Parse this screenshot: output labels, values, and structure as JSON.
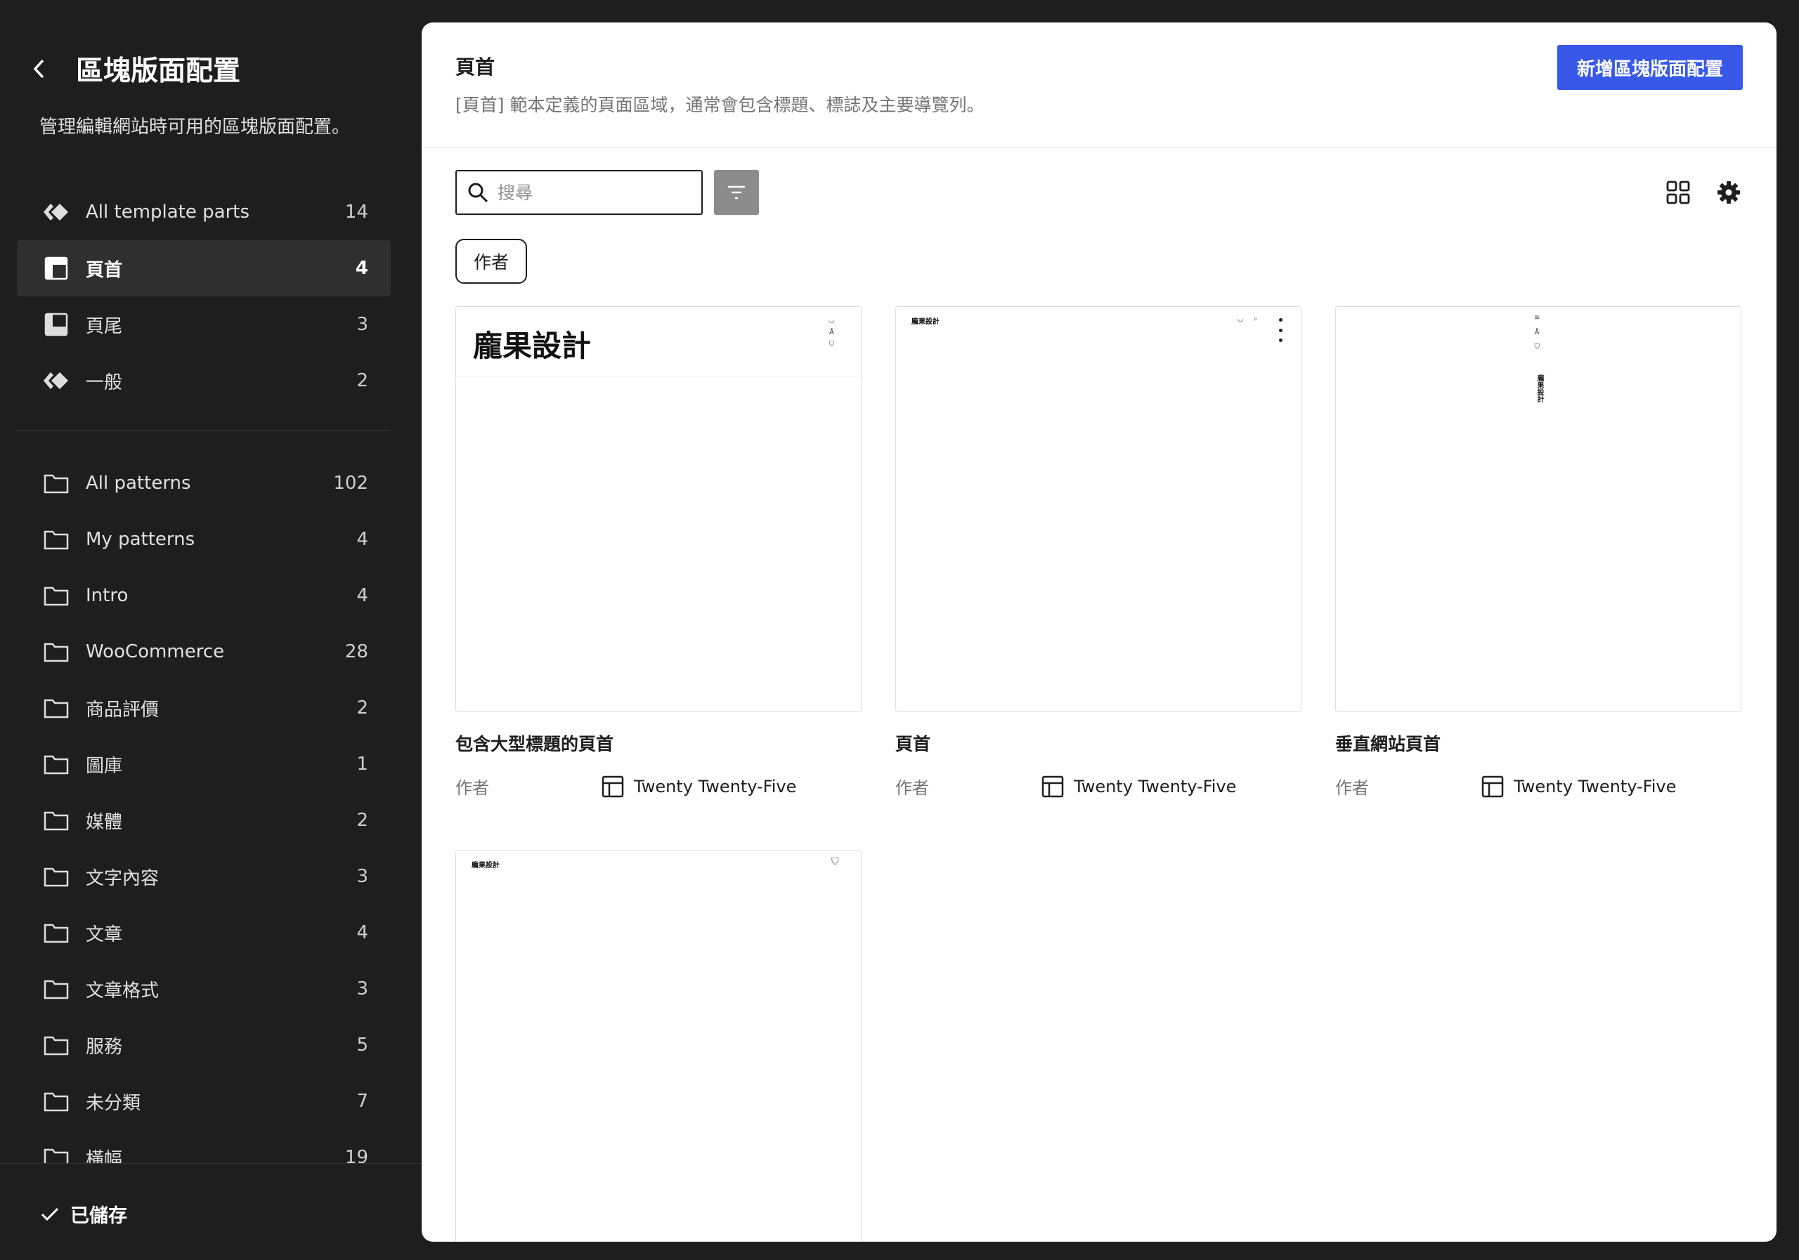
{
  "sidebar": {
    "title": "區塊版面配置",
    "description": "管理編輯網站時可用的區塊版面配置。",
    "template_parts": [
      {
        "label": "All template parts",
        "count": "14",
        "icon": "diamond-icon"
      },
      {
        "label": "頁首",
        "count": "4",
        "icon": "header-icon"
      },
      {
        "label": "頁尾",
        "count": "3",
        "icon": "footer-icon"
      },
      {
        "label": "一般",
        "count": "2",
        "icon": "diamond-icon"
      }
    ],
    "pattern_categories": [
      {
        "label": "All patterns",
        "count": "102"
      },
      {
        "label": "My patterns",
        "count": "4"
      },
      {
        "label": "Intro",
        "count": "4"
      },
      {
        "label": "WooCommerce",
        "count": "28"
      },
      {
        "label": "商品評價",
        "count": "2"
      },
      {
        "label": "圖庫",
        "count": "1"
      },
      {
        "label": "媒體",
        "count": "2"
      },
      {
        "label": "文字內容",
        "count": "3"
      },
      {
        "label": "文章",
        "count": "4"
      },
      {
        "label": "文章格式",
        "count": "3"
      },
      {
        "label": "服務",
        "count": "5"
      },
      {
        "label": "未分類",
        "count": "7"
      },
      {
        "label": "橫幅",
        "count": "19"
      }
    ],
    "saved_label": "已儲存"
  },
  "main": {
    "title": "頁首",
    "description": "[頁首] 範本定義的頁面區域，通常會包含標題、標誌及主要導覽列。",
    "add_button": "新增區塊版面配置",
    "search_placeholder": "搜尋",
    "filter_chip": "作者",
    "cards": [
      {
        "title": "包含大型標題的頁首",
        "author_label": "作者",
        "theme": "Twenty Twenty-Five",
        "preview_site": "龐果設計"
      },
      {
        "title": "頁首",
        "author_label": "作者",
        "theme": "Twenty Twenty-Five",
        "preview_site": "龐果設計"
      },
      {
        "title": "垂直網站頁首",
        "author_label": "作者",
        "theme": "Twenty Twenty-Five",
        "preview_site": "龐果設計"
      },
      {
        "title": "",
        "author_label": "",
        "theme": "",
        "preview_site": "龐果設計"
      }
    ]
  },
  "colors": {
    "accent": "#3858e9",
    "sidebar_bg": "#1e1e1e",
    "active_item_bg": "#2f2f2f"
  }
}
